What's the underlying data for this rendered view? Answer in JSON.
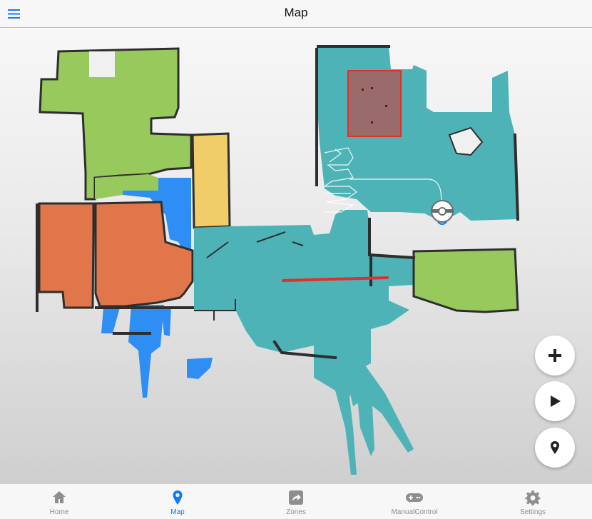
{
  "header": {
    "title": "Map"
  },
  "fabs": {
    "add_icon": "plus-icon",
    "play_icon": "play-icon",
    "pin_icon": "location-pin-icon"
  },
  "tabs": [
    {
      "label": "Home",
      "icon": "home-icon",
      "active": false
    },
    {
      "label": "Map",
      "icon": "location-pin-icon",
      "active": true
    },
    {
      "label": "Zones",
      "icon": "share-arrow-icon",
      "active": false
    },
    {
      "label": "ManualControl",
      "icon": "gamepad-icon",
      "active": false
    },
    {
      "label": "Settings",
      "icon": "gear-icon",
      "active": false
    }
  ],
  "colors": {
    "accent": "#0a7cff",
    "room_green": "#98c95c",
    "room_orange": "#e0764a",
    "room_yellow": "#f1cd6a",
    "room_teal": "#4db3b6",
    "room_blue": "#2f8ef3",
    "zone_fill": "#9a6b6b",
    "zone_border": "#e0302a",
    "virtual_wall": "#e0302a",
    "wall": "#2e2e2e"
  }
}
